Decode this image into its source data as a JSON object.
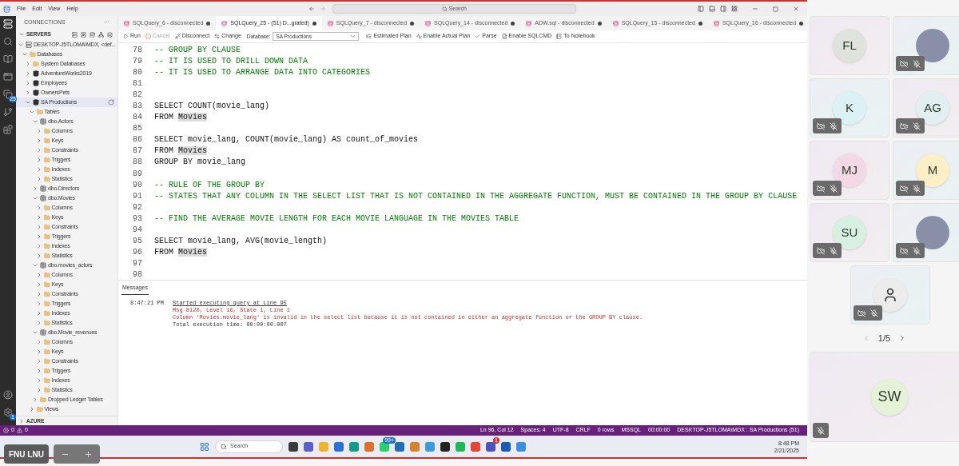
{
  "menu": [
    "File",
    "Edit",
    "View",
    "Help"
  ],
  "title_search": "Search",
  "activity_badges": {
    "files": "25",
    "settings": "1"
  },
  "sidebar": {
    "title": "CONNECTIONS",
    "more": "···",
    "section": "SERVERS",
    "footer": "AZURE",
    "tree": [
      {
        "label": "DESKTOP-J5TLOMA\\MDX, <def...",
        "kind": "server",
        "expanded": true,
        "selected": false,
        "children": [
          {
            "label": "Databases",
            "kind": "folder",
            "expanded": true,
            "selected": false,
            "children": [
              {
                "label": "System Databases",
                "kind": "folder",
                "expanded": false,
                "selected": false
              },
              {
                "label": "AdventureWorks2019",
                "kind": "database",
                "expanded": false,
                "selected": false
              },
              {
                "label": "Employees",
                "kind": "database",
                "expanded": false,
                "selected": false
              },
              {
                "label": "OwnersPets",
                "kind": "database",
                "expanded": false,
                "selected": false
              },
              {
                "label": "SA Productions",
                "kind": "database",
                "expanded": true,
                "selected": true,
                "children": [
                  {
                    "label": "Tables",
                    "kind": "folder",
                    "expanded": true,
                    "selected": false,
                    "children": [
                      {
                        "label": "dbo.Actors",
                        "kind": "table",
                        "expanded": true,
                        "selected": false,
                        "children": [
                          {
                            "label": "Columns",
                            "kind": "folder",
                            "expanded": false,
                            "selected": false
                          },
                          {
                            "label": "Keys",
                            "kind": "folder",
                            "expanded": false,
                            "selected": false
                          },
                          {
                            "label": "Constraints",
                            "kind": "folder",
                            "expanded": false,
                            "selected": false
                          },
                          {
                            "label": "Triggers",
                            "kind": "folder",
                            "expanded": false,
                            "selected": false
                          },
                          {
                            "label": "Indexes",
                            "kind": "folder",
                            "expanded": false,
                            "selected": false
                          },
                          {
                            "label": "Statistics",
                            "kind": "folder",
                            "expanded": false,
                            "selected": false
                          }
                        ]
                      },
                      {
                        "label": "dbo.Directors",
                        "kind": "table",
                        "expanded": false,
                        "selected": false
                      },
                      {
                        "label": "dbo.Movies",
                        "kind": "table",
                        "expanded": true,
                        "selected": false,
                        "children": [
                          {
                            "label": "Columns",
                            "kind": "folder",
                            "expanded": false,
                            "selected": false
                          },
                          {
                            "label": "Keys",
                            "kind": "folder",
                            "expanded": false,
                            "selected": false
                          },
                          {
                            "label": "Constraints",
                            "kind": "folder",
                            "expanded": false,
                            "selected": false
                          },
                          {
                            "label": "Triggers",
                            "kind": "folder",
                            "expanded": false,
                            "selected": false
                          },
                          {
                            "label": "Indexes",
                            "kind": "folder",
                            "expanded": false,
                            "selected": false
                          },
                          {
                            "label": "Statistics",
                            "kind": "folder",
                            "expanded": false,
                            "selected": false
                          }
                        ]
                      },
                      {
                        "label": "dbo.movies_actors",
                        "kind": "table",
                        "expanded": true,
                        "selected": false,
                        "children": [
                          {
                            "label": "Columns",
                            "kind": "folder",
                            "expanded": false,
                            "selected": false
                          },
                          {
                            "label": "Keys",
                            "kind": "folder",
                            "expanded": false,
                            "selected": false
                          },
                          {
                            "label": "Constraints",
                            "kind": "folder",
                            "expanded": false,
                            "selected": false
                          },
                          {
                            "label": "Triggers",
                            "kind": "folder",
                            "expanded": false,
                            "selected": false
                          },
                          {
                            "label": "Indexes",
                            "kind": "folder",
                            "expanded": false,
                            "selected": false
                          },
                          {
                            "label": "Statistics",
                            "kind": "folder",
                            "expanded": false,
                            "selected": false
                          }
                        ]
                      },
                      {
                        "label": "dbo.Movie_revenues",
                        "kind": "table",
                        "expanded": true,
                        "selected": false,
                        "children": [
                          {
                            "label": "Columns",
                            "kind": "folder",
                            "expanded": false,
                            "selected": false
                          },
                          {
                            "label": "Keys",
                            "kind": "folder",
                            "expanded": false,
                            "selected": false
                          },
                          {
                            "label": "Constraints",
                            "kind": "folder",
                            "expanded": false,
                            "selected": false
                          },
                          {
                            "label": "Triggers",
                            "kind": "folder",
                            "expanded": false,
                            "selected": false
                          },
                          {
                            "label": "Indexes",
                            "kind": "folder",
                            "expanded": false,
                            "selected": false
                          },
                          {
                            "label": "Statistics",
                            "kind": "folder",
                            "expanded": false,
                            "selected": false
                          }
                        ]
                      },
                      {
                        "label": "Dropped Ledger Tables",
                        "kind": "folder",
                        "expanded": false,
                        "selected": false
                      }
                    ]
                  },
                  {
                    "label": "Views",
                    "kind": "folder",
                    "expanded": false,
                    "selected": false
                  }
                ]
              }
            ]
          }
        ]
      }
    ]
  },
  "tabs": [
    {
      "label": "SQLQuery_6 - disconnected",
      "selected": false
    },
    {
      "label": "SQLQuery_25 - (51) D...grated)",
      "selected": true
    },
    {
      "label": "SQLQuery_7 - disconnected",
      "selected": false
    },
    {
      "label": "SQLQuery_14 - disconnected",
      "selected": false
    },
    {
      "label": "ADW.sql - disconnected",
      "selected": false
    },
    {
      "label": "SQLQuery_15 - disconnected",
      "selected": false
    },
    {
      "label": "SQLQuery_16 - disconnected",
      "selected": false
    }
  ],
  "toolbar": {
    "left": [
      {
        "kind": "run",
        "label": "Run",
        "disabled": false
      },
      {
        "kind": "cancel",
        "label": "Cancel",
        "disabled": true
      },
      {
        "kind": "disconnect",
        "label": "Disconnect",
        "disabled": false
      },
      {
        "kind": "change",
        "label": "Change",
        "disabled": false
      }
    ],
    "database_label": "Database:",
    "database": "SA Productions",
    "right": [
      {
        "kind": "plan",
        "label": "Estimated Plan",
        "disabled": false
      },
      {
        "kind": "actual",
        "label": "Enable Actual Plan",
        "disabled": false
      },
      {
        "kind": "parse",
        "label": "Parse",
        "disabled": false
      },
      {
        "kind": "sqlcmd",
        "label": "Enable SQLCMD",
        "disabled": false
      },
      {
        "kind": "notebook",
        "label": "To Notebook",
        "disabled": false
      }
    ]
  },
  "editor": {
    "lines": [
      {
        "number": "78",
        "kind": "comment",
        "segments": [
          {
            "text": "-- GROUP BY CLAUSE",
            "highlighted": false
          }
        ]
      },
      {
        "number": "79",
        "kind": "comment",
        "segments": [
          {
            "text": "-- IT IS USED TO DRILL DOWN DATA",
            "highlighted": false
          }
        ]
      },
      {
        "number": "80",
        "kind": "comment",
        "segments": [
          {
            "text": "-- IT IS USED TO ARRANGE DATA INTO CATEGORIES",
            "highlighted": false
          }
        ]
      },
      {
        "number": "81",
        "kind": "blank"
      },
      {
        "number": "82",
        "kind": "blank"
      },
      {
        "number": "83",
        "kind": "code",
        "segments": [
          {
            "text": "SELECT COUNT(movie_lang)",
            "highlighted": false
          }
        ]
      },
      {
        "number": "84",
        "kind": "code",
        "segments": [
          {
            "text": "FROM ",
            "highlighted": false
          },
          {
            "text": "Movies",
            "highlighted": true
          }
        ]
      },
      {
        "number": "85",
        "kind": "blank"
      },
      {
        "number": "86",
        "kind": "code",
        "segments": [
          {
            "text": "SELECT movie_lang, COUNT(movie_lang) AS count_of_movies",
            "highlighted": false
          }
        ]
      },
      {
        "number": "87",
        "kind": "code",
        "segments": [
          {
            "text": "FROM ",
            "highlighted": false
          },
          {
            "text": "Movies",
            "highlighted": true
          }
        ]
      },
      {
        "number": "88",
        "kind": "code",
        "segments": [
          {
            "text": "GROUP BY movie_lang",
            "highlighted": false
          }
        ]
      },
      {
        "number": "89",
        "kind": "blank"
      },
      {
        "number": "90",
        "kind": "comment",
        "segments": [
          {
            "text": "-- RULE OF THE GROUP BY",
            "highlighted": false
          }
        ]
      },
      {
        "number": "91",
        "kind": "comment",
        "segments": [
          {
            "text": "-- STATES THAT ANY COLUMN IN THE SELECT LIST THAT IS NOT CONTAINED IN THE AGGREGATE FUNCTION, MUST BE CONTAINED IN THE GROUP BY CLAUSE",
            "highlighted": false
          }
        ]
      },
      {
        "number": "92",
        "kind": "blank"
      },
      {
        "number": "93",
        "kind": "comment",
        "segments": [
          {
            "text": "-- FIND THE AVERAGE MOVIE LENGTH FOR EACH MOVIE LANGUAGE IN THE MOVIES TABLE",
            "highlighted": false
          }
        ]
      },
      {
        "number": "94",
        "kind": "blank"
      },
      {
        "number": "95",
        "kind": "code",
        "segments": [
          {
            "text": "SELECT movie_lang, AVG(movie_length)",
            "highlighted": false
          }
        ]
      },
      {
        "number": "96",
        "kind": "code",
        "segments": [
          {
            "text": "FROM ",
            "highlighted": false
          },
          {
            "text": "Movies",
            "highlighted": true
          }
        ]
      },
      {
        "number": "97",
        "kind": "blank"
      },
      {
        "number": "98",
        "kind": "blank"
      }
    ]
  },
  "messages": {
    "tabs": [
      {
        "label": "Messages",
        "selected": true
      }
    ],
    "time": "8:47:21 PM",
    "lines": [
      {
        "kind": "link",
        "text": "Started executing query at Line 95"
      },
      {
        "kind": "error",
        "text": "Msg 8120, Level 16, State 1, Line 1"
      },
      {
        "kind": "error",
        "text": "Column 'Movies.movie_lang' is invalid in the select list because it is not contained in either an aggregate function or the GROUP BY clause."
      },
      {
        "kind": "info",
        "text": "Total execution time: 00:00:00.007"
      }
    ]
  },
  "status_bar": {
    "errors": "0",
    "warnings": "0",
    "items": [
      "Ln 96, Col 12",
      "Spaces: 4",
      "UTF-8",
      "CRLF",
      "0 rows",
      "MSSQL",
      "00:00:00",
      "DESKTOP-J5TLOMA\\MDX : SA Productions (51)"
    ]
  },
  "taskbar": {
    "search_placeholder": "Search",
    "badges": [
      "99+",
      "1"
    ],
    "time": "8:48 PM",
    "date": "2/21/2025"
  },
  "presenter": {
    "name": "FNU LNU"
  },
  "participants": [
    {
      "kind": "initials",
      "initials": "FL",
      "color": "#dfe3dc",
      "camera_off": false,
      "muted": false
    },
    {
      "kind": "photo",
      "camera_off": true,
      "muted": true
    },
    {
      "kind": "initials",
      "initials": "K",
      "color": "#dcf1f4",
      "camera_off": true,
      "muted": true
    },
    {
      "kind": "initials",
      "initials": "AG",
      "color": "#e2eff1",
      "camera_off": true,
      "muted": true
    },
    {
      "kind": "initials",
      "initials": "MJ",
      "color": "#f3d8e6",
      "camera_off": true,
      "muted": true
    },
    {
      "kind": "initials",
      "initials": "M",
      "color": "#fcefc6",
      "camera_off": true,
      "muted": true
    },
    {
      "kind": "initials",
      "initials": "SU",
      "color": "#d8f0e1",
      "camera_off": true,
      "muted": true
    },
    {
      "kind": "photo",
      "camera_off": true,
      "muted": true
    },
    {
      "kind": "generic",
      "camera_off": true,
      "muted": true
    }
  ],
  "pager": "1/5",
  "featured": {
    "kind": "initials",
    "initials": "SW",
    "color": "#e5f2d8",
    "camera_off": false,
    "muted": true
  }
}
